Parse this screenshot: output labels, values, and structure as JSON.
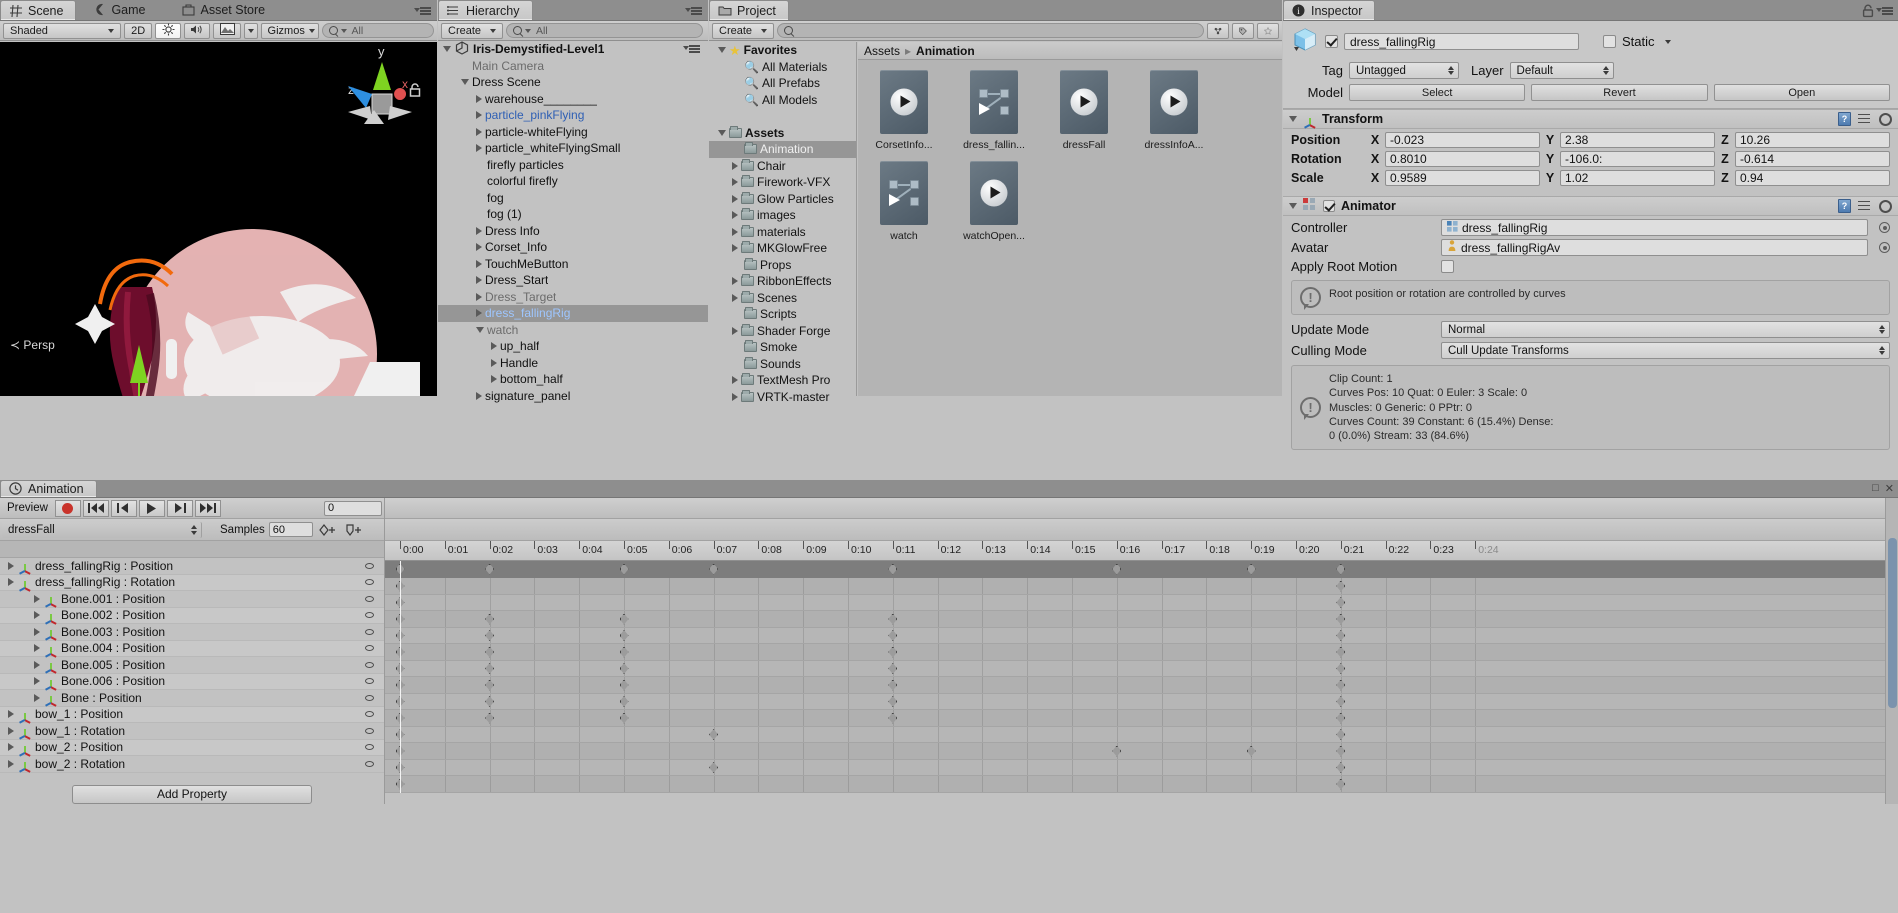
{
  "scene": {
    "tabs": [
      {
        "label": "Scene",
        "icon": "grid-icon",
        "active": true
      },
      {
        "label": "Game",
        "icon": "gamepad-icon",
        "active": false
      },
      {
        "label": "Asset Store",
        "icon": "store-icon",
        "active": false
      }
    ],
    "toolbar": {
      "draw_mode": "Shaded",
      "mode_2d": "2D",
      "lighting_icon": "sun-icon",
      "audio_icon": "speaker-icon",
      "fx_icon": "image-icon",
      "gizmos": "Gizmos",
      "search_placeholder": "All"
    },
    "gizmo": {
      "x": "x",
      "y": "y",
      "z": "z"
    },
    "persp_label": "Persp"
  },
  "hierarchy": {
    "tab": "Hierarchy",
    "create_label": "Create",
    "search_placeholder": "All",
    "root": "Iris-Demystified-Level1",
    "items": [
      {
        "label": "Main Camera",
        "depth": 1,
        "arrow": "none",
        "style": "dim"
      },
      {
        "label": "Dress Scene",
        "depth": 1,
        "arrow": "open",
        "style": "normal"
      },
      {
        "label": "warehouse________",
        "depth": 2,
        "arrow": "closed",
        "style": "normal"
      },
      {
        "label": "particle_pinkFlying",
        "depth": 2,
        "arrow": "closed",
        "style": "prefab"
      },
      {
        "label": "particle-whiteFlying",
        "depth": 2,
        "arrow": "closed",
        "style": "normal"
      },
      {
        "label": "particle_whiteFlyingSmall",
        "depth": 2,
        "arrow": "closed",
        "style": "normal"
      },
      {
        "label": "firefly particles",
        "depth": 2,
        "arrow": "none",
        "style": "normal"
      },
      {
        "label": "colorful firefly",
        "depth": 2,
        "arrow": "none",
        "style": "normal"
      },
      {
        "label": "fog",
        "depth": 2,
        "arrow": "none",
        "style": "normal"
      },
      {
        "label": "fog (1)",
        "depth": 2,
        "arrow": "none",
        "style": "normal"
      },
      {
        "label": "Dress Info",
        "depth": 2,
        "arrow": "closed",
        "style": "normal"
      },
      {
        "label": "Corset_Info",
        "depth": 2,
        "arrow": "closed",
        "style": "normal"
      },
      {
        "label": "TouchMeButton",
        "depth": 2,
        "arrow": "closed",
        "style": "normal"
      },
      {
        "label": "Dress_Start",
        "depth": 2,
        "arrow": "closed",
        "style": "normal"
      },
      {
        "label": "Dress_Target",
        "depth": 2,
        "arrow": "closed",
        "style": "dim"
      },
      {
        "label": "dress_fallingRig",
        "depth": 2,
        "arrow": "closed",
        "style": "prefab",
        "selected": true
      },
      {
        "label": "watch",
        "depth": 2,
        "arrow": "open",
        "style": "dim"
      },
      {
        "label": "up_half",
        "depth": 3,
        "arrow": "closed",
        "style": "normal"
      },
      {
        "label": "Handle",
        "depth": 3,
        "arrow": "closed",
        "style": "normal"
      },
      {
        "label": "bottom_half",
        "depth": 3,
        "arrow": "closed",
        "style": "normal"
      },
      {
        "label": "signature_panel",
        "depth": 2,
        "arrow": "closed",
        "style": "normal"
      }
    ]
  },
  "project": {
    "tab": "Project",
    "create_label": "Create",
    "search_placeholder": "",
    "tree": [
      {
        "label": "Favorites",
        "depth": 0,
        "arrow": "open",
        "icon": "star",
        "bold": true
      },
      {
        "label": "All Materials",
        "depth": 1,
        "arrow": "none",
        "icon": "search"
      },
      {
        "label": "All Prefabs",
        "depth": 1,
        "arrow": "none",
        "icon": "search"
      },
      {
        "label": "All Models",
        "depth": 1,
        "arrow": "none",
        "icon": "search"
      },
      {
        "label": "",
        "depth": 0,
        "arrow": "none",
        "icon": "none"
      },
      {
        "label": "Assets",
        "depth": 0,
        "arrow": "open",
        "icon": "folder",
        "bold": true
      },
      {
        "label": "Animation",
        "depth": 1,
        "arrow": "none",
        "icon": "folder",
        "selected": true
      },
      {
        "label": "Chair",
        "depth": 1,
        "arrow": "closed",
        "icon": "folder"
      },
      {
        "label": "Firework-VFX",
        "depth": 1,
        "arrow": "closed",
        "icon": "folder"
      },
      {
        "label": "Glow Particles",
        "depth": 1,
        "arrow": "closed",
        "icon": "folder"
      },
      {
        "label": "images",
        "depth": 1,
        "arrow": "closed",
        "icon": "folder"
      },
      {
        "label": "materials",
        "depth": 1,
        "arrow": "closed",
        "icon": "folder"
      },
      {
        "label": "MKGlowFree",
        "depth": 1,
        "arrow": "closed",
        "icon": "folder"
      },
      {
        "label": "Props",
        "depth": 1,
        "arrow": "none",
        "icon": "folder"
      },
      {
        "label": "RibbonEffects",
        "depth": 1,
        "arrow": "closed",
        "icon": "folder"
      },
      {
        "label": "Scenes",
        "depth": 1,
        "arrow": "closed",
        "icon": "folder"
      },
      {
        "label": "Scripts",
        "depth": 1,
        "arrow": "none",
        "icon": "folder"
      },
      {
        "label": "Shader Forge",
        "depth": 1,
        "arrow": "closed",
        "icon": "folder"
      },
      {
        "label": "Smoke",
        "depth": 1,
        "arrow": "none",
        "icon": "folder"
      },
      {
        "label": "Sounds",
        "depth": 1,
        "arrow": "none",
        "icon": "folder"
      },
      {
        "label": "TextMesh Pro",
        "depth": 1,
        "arrow": "closed",
        "icon": "folder"
      },
      {
        "label": "VRTK-master",
        "depth": 1,
        "arrow": "closed",
        "icon": "folder"
      }
    ],
    "breadcrumb": [
      "Assets",
      "Animation"
    ],
    "assets": [
      {
        "label": "CorsetInfo...",
        "type": "animation-clip"
      },
      {
        "label": "dress_fallin...",
        "type": "animator-controller"
      },
      {
        "label": "dressFall",
        "type": "animation-clip"
      },
      {
        "label": "dressInfoA...",
        "type": "animation-clip"
      },
      {
        "label": "watch",
        "type": "animator-controller"
      },
      {
        "label": "watchOpen...",
        "type": "animation-clip"
      }
    ]
  },
  "inspector": {
    "tab": "Inspector",
    "object_name": "dress_fallingRig",
    "enabled": true,
    "static_label": "Static",
    "static_checked": false,
    "tag_label": "Tag",
    "tag_value": "Untagged",
    "layer_label": "Layer",
    "layer_value": "Default",
    "model_label": "Model",
    "model_buttons": [
      "Select",
      "Revert",
      "Open"
    ],
    "transform": {
      "title": "Transform",
      "rows": [
        {
          "label": "Position",
          "x": "-0.023",
          "y": "2.38",
          "z": "10.26"
        },
        {
          "label": "Rotation",
          "x": "0.8010",
          "y": "-106.0:",
          "z": "-0.614"
        },
        {
          "label": "Scale",
          "x": "0.9589",
          "y": "1.02",
          "z": "0.94"
        }
      ]
    },
    "animator": {
      "title": "Animator",
      "enabled": true,
      "controller_label": "Controller",
      "controller_value": "dress_fallingRig",
      "avatar_label": "Avatar",
      "avatar_value": "dress_fallingRigAv",
      "apply_root_motion_label": "Apply Root Motion",
      "apply_root_motion_checked": false,
      "warning": "Root position or rotation are controlled by curves",
      "update_mode_label": "Update Mode",
      "update_mode_value": "Normal",
      "culling_mode_label": "Culling Mode",
      "culling_mode_value": "Cull Update Transforms",
      "stats": [
        "Clip Count: 1",
        "Curves Pos: 10 Quat: 0 Euler: 3 Scale: 0",
        "Muscles: 0 Generic: 0 PPtr: 0",
        "Curves Count: 39 Constant: 6 (15.4%) Dense:",
        "0 (0.0%) Stream: 33 (84.6%)"
      ]
    }
  },
  "animation": {
    "tab": "Animation",
    "preview_label": "Preview",
    "record_icon": "record-icon",
    "transport": [
      "first-key-icon",
      "prev-key-icon",
      "play-icon",
      "next-key-icon",
      "last-key-icon"
    ],
    "frame_field": "0",
    "clip_value": "dressFall",
    "samples_label": "Samples",
    "samples_value": "60",
    "add_keyframe_icon": "add-keyframe-icon",
    "add_event_icon": "add-event-icon",
    "add_property_label": "Add Property",
    "ruler_labels": [
      "0:00",
      "0:01",
      "0:02",
      "0:03",
      "0:04",
      "0:05",
      "0:06",
      "0:07",
      "0:08",
      "0:09",
      "0:10",
      "0:11",
      "0:12",
      "0:13",
      "0:14",
      "0:15",
      "0:16",
      "0:17",
      "0:18",
      "0:19",
      "0:20",
      "0:21",
      "0:22",
      "0:23",
      "0:24"
    ],
    "ruler_last_dim": "0:24",
    "properties": [
      {
        "label": "dress_fallingRig : Position",
        "depth": 0,
        "arrow": "closed"
      },
      {
        "label": "dress_fallingRig : Rotation",
        "depth": 0,
        "arrow": "closed"
      },
      {
        "label": "Bone.001 : Position",
        "depth": 1,
        "arrow": "closed"
      },
      {
        "label": "Bone.002 : Position",
        "depth": 1,
        "arrow": "closed"
      },
      {
        "label": "Bone.003 : Position",
        "depth": 1,
        "arrow": "closed"
      },
      {
        "label": "Bone.004 : Position",
        "depth": 1,
        "arrow": "closed"
      },
      {
        "label": "Bone.005 : Position",
        "depth": 1,
        "arrow": "closed"
      },
      {
        "label": "Bone.006 : Position",
        "depth": 1,
        "arrow": "closed"
      },
      {
        "label": "Bone : Position",
        "depth": 1,
        "arrow": "closed"
      },
      {
        "label": "bow_1 : Position",
        "depth": 0,
        "arrow": "closed"
      },
      {
        "label": "bow_1 : Rotation",
        "depth": 0,
        "arrow": "closed"
      },
      {
        "label": "bow_2 : Position",
        "depth": 0,
        "arrow": "closed"
      },
      {
        "label": "bow_2 : Rotation",
        "depth": 0,
        "arrow": "closed"
      }
    ],
    "summary_keys": [
      0,
      2,
      5,
      7,
      11,
      16,
      19,
      21
    ],
    "row_keys": [
      [
        0,
        21
      ],
      [
        0,
        21
      ],
      [
        0,
        2,
        5,
        11,
        21
      ],
      [
        0,
        2,
        5,
        11,
        21
      ],
      [
        0,
        2,
        5,
        11,
        21
      ],
      [
        0,
        2,
        5,
        11,
        21
      ],
      [
        0,
        2,
        5,
        11,
        21
      ],
      [
        0,
        2,
        5,
        11,
        21
      ],
      [
        0,
        2,
        5,
        11,
        21
      ],
      [
        0,
        7,
        21
      ],
      [
        0,
        16,
        19,
        21
      ],
      [
        0,
        7,
        21
      ],
      [
        0,
        21
      ]
    ],
    "playhead_time": 0
  }
}
